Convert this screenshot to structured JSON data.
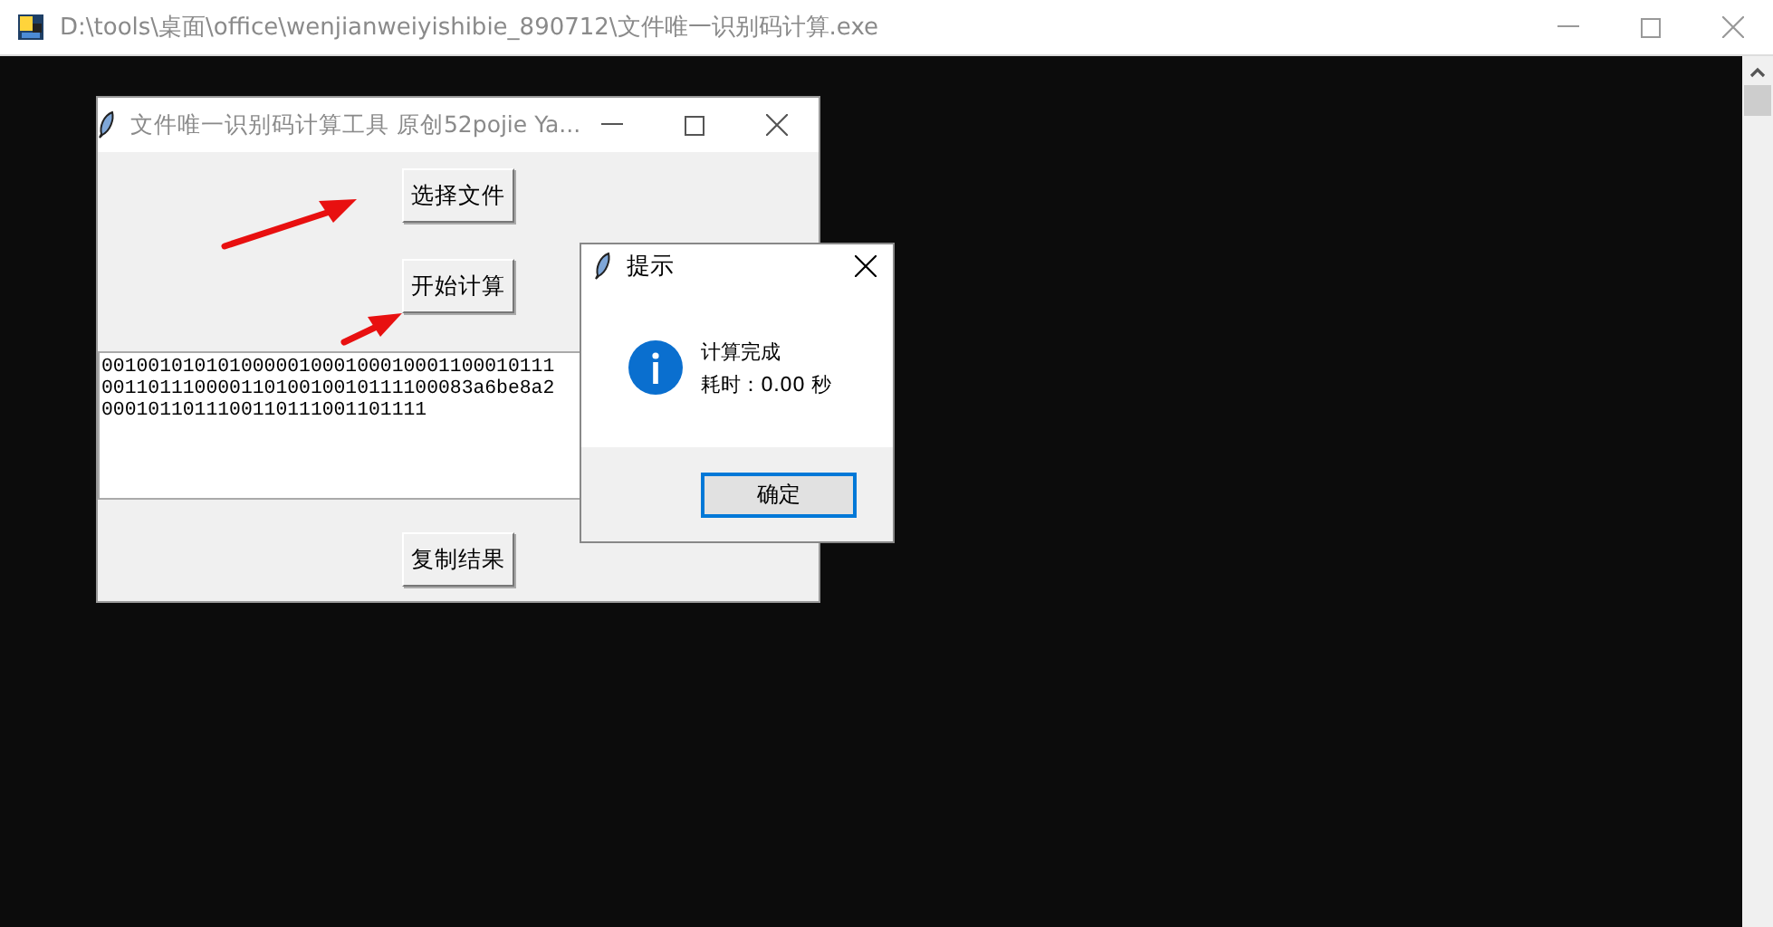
{
  "console_window": {
    "title": "D:\\tools\\桌面\\office\\wenjianweiyishibie_890712\\文件唯一识别码计算.exe",
    "active": false
  },
  "app_window": {
    "title": "文件唯一识别码计算工具 原创52pojie Ya...",
    "active": false,
    "buttons": [
      {
        "label": "选择文件"
      },
      {
        "label": "开始计算"
      }
    ],
    "output_lines": [
      "001001010101000001000100010001100010111",
      "00110111000011010010010111100083a6be8a2",
      "0001011011100110111001101111"
    ],
    "copy_button": {
      "label": "复制结果"
    }
  },
  "dialog": {
    "title": "提示",
    "active": true,
    "message": "计算完成",
    "detail": "耗时：0.00 秒",
    "ok_button": {
      "label": "确定",
      "focused": true
    }
  }
}
